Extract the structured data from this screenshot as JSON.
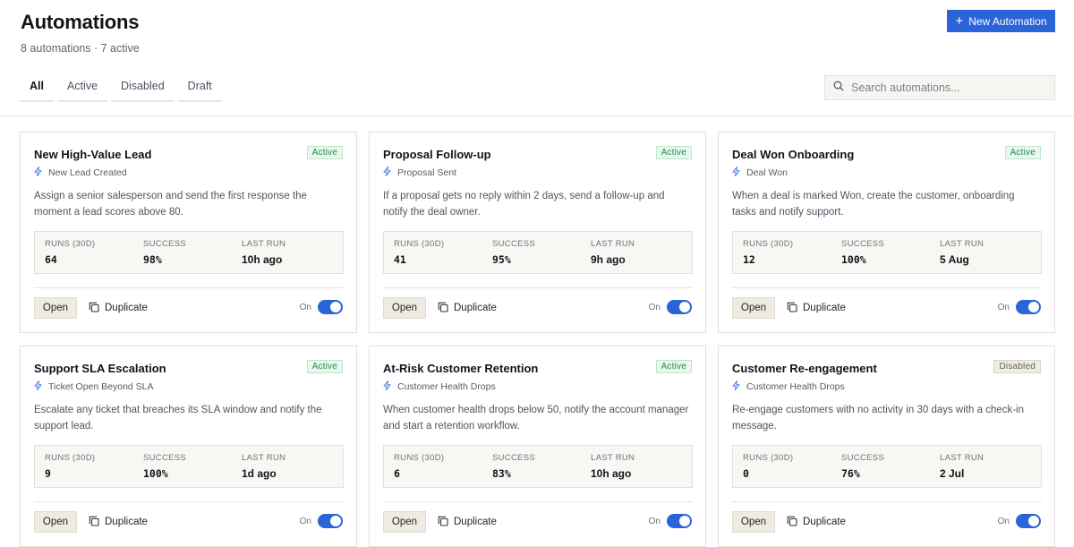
{
  "header": {
    "title": "Automations",
    "subtitle": "8 automations · 7 active",
    "new_button_label": "New Automation"
  },
  "tabs": [
    {
      "label": "All",
      "active": true
    },
    {
      "label": "Active",
      "active": false
    },
    {
      "label": "Disabled",
      "active": false
    },
    {
      "label": "Draft",
      "active": false
    }
  ],
  "search": {
    "placeholder": "Search automations..."
  },
  "stat_labels": {
    "runs": "RUNS (30D)",
    "success": "SUCCESS",
    "last_run": "LAST RUN"
  },
  "card_actions": {
    "open": "Open",
    "duplicate": "Duplicate",
    "toggle_label": "On"
  },
  "colors": {
    "accent": "#2b63d9",
    "active_badge": "#1e8a4c",
    "disabled_badge": "#6a6356"
  },
  "automations": [
    {
      "name": "New High-Value Lead",
      "status": "Active",
      "trigger": "New Lead Created",
      "description": "Assign a senior salesperson and send the first response the moment a lead scores above 80.",
      "runs": "64",
      "success": "98%",
      "last_run": "10h ago"
    },
    {
      "name": "Proposal Follow-up",
      "status": "Active",
      "trigger": "Proposal Sent",
      "description": "If a proposal gets no reply within 2 days, send a follow-up and notify the deal owner.",
      "runs": "41",
      "success": "95%",
      "last_run": "9h ago"
    },
    {
      "name": "Deal Won Onboarding",
      "status": "Active",
      "trigger": "Deal Won",
      "description": "When a deal is marked Won, create the customer, onboarding tasks and notify support.",
      "runs": "12",
      "success": "100%",
      "last_run": "5 Aug"
    },
    {
      "name": "Support SLA Escalation",
      "status": "Active",
      "trigger": "Ticket Open Beyond SLA",
      "description": "Escalate any ticket that breaches its SLA window and notify the support lead.",
      "runs": "9",
      "success": "100%",
      "last_run": "1d ago"
    },
    {
      "name": "At-Risk Customer Retention",
      "status": "Active",
      "trigger": "Customer Health Drops",
      "description": "When customer health drops below 50, notify the account manager and start a retention workflow.",
      "runs": "6",
      "success": "83%",
      "last_run": "10h ago"
    },
    {
      "name": "Customer Re-engagement",
      "status": "Disabled",
      "trigger": "Customer Health Drops",
      "description": "Re-engage customers with no activity in 30 days with a check-in message.",
      "runs": "0",
      "success": "76%",
      "last_run": "2 Jul"
    }
  ]
}
